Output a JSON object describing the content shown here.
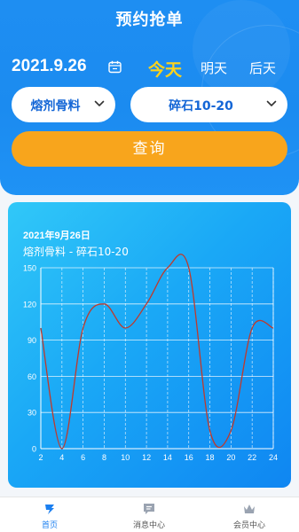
{
  "app": {
    "title": "预约抢单"
  },
  "date_bar": {
    "date": "2021.9.26",
    "days": [
      "今天",
      "明天",
      "后天"
    ],
    "active_day": "今天"
  },
  "filters": {
    "material": "熔剂骨料",
    "spec": "碎石10-20"
  },
  "query_button": {
    "label": "查询"
  },
  "card": {
    "date": "2021年9月26日",
    "subtitle": "熔剂骨料 - 碎石10-20"
  },
  "chart_data": {
    "type": "line",
    "x": [
      2,
      4,
      6,
      8,
      10,
      12,
      14,
      16,
      18,
      20,
      22,
      24
    ],
    "y": [
      100,
      0,
      100,
      120,
      100,
      120,
      150,
      150,
      15,
      15,
      100,
      100
    ],
    "xlim": [
      2,
      24
    ],
    "ylim": [
      0,
      150
    ],
    "x_ticks": [
      2,
      4,
      6,
      8,
      10,
      12,
      14,
      16,
      18,
      20,
      22,
      24
    ],
    "y_ticks": [
      0,
      30,
      60,
      90,
      120,
      150
    ],
    "grid": true,
    "line_color": "#c0392b"
  },
  "tabbar": {
    "items": [
      {
        "label": "首页",
        "icon": "home-logo-icon",
        "active": true
      },
      {
        "label": "消息中心",
        "icon": "message-icon",
        "active": false
      },
      {
        "label": "会员中心",
        "icon": "crown-icon",
        "active": false
      }
    ]
  },
  "colors": {
    "primary": "#1b8bf0",
    "accent": "#f8a51c",
    "today": "#ffd21a"
  }
}
